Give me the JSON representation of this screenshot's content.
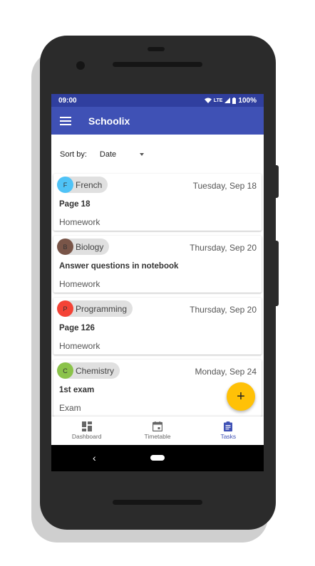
{
  "status_bar": {
    "time": "09:00",
    "network": "LTE",
    "battery": "100%"
  },
  "app_bar": {
    "title": "Schoolix",
    "menu_icon": "hamburger-menu-icon"
  },
  "sort": {
    "label": "Sort by:",
    "value": "Date"
  },
  "tasks": [
    {
      "subject": "French",
      "initial": "F",
      "avatar_color": "#4fc3f7",
      "due": "Tuesday, Sep 18",
      "title": "Page 18",
      "type": "Homework"
    },
    {
      "subject": "Biology",
      "initial": "B",
      "avatar_color": "#795548",
      "due": "Thursday, Sep 20",
      "title": "Answer questions in notebook",
      "type": "Homework"
    },
    {
      "subject": "Programming",
      "initial": "P",
      "avatar_color": "#f44336",
      "due": "Thursday, Sep 20",
      "title": "Page 126",
      "type": "Homework"
    },
    {
      "subject": "Chemistry",
      "initial": "C",
      "avatar_color": "#8bc34a",
      "due": "Monday, Sep 24",
      "title": "1st exam",
      "type": "Exam"
    }
  ],
  "fab": {
    "label": "+",
    "icon": "add-icon"
  },
  "bottom_nav": [
    {
      "label": "Dashboard",
      "icon": "dashboard-icon",
      "active": false
    },
    {
      "label": "Timetable",
      "icon": "calendar-icon",
      "active": false
    },
    {
      "label": "Tasks",
      "icon": "clipboard-icon",
      "active": true
    }
  ],
  "system_nav": {
    "back": "‹"
  },
  "colors": {
    "primary": "#3f51b5",
    "primary_dark": "#303f9f",
    "accent": "#ffc107"
  }
}
